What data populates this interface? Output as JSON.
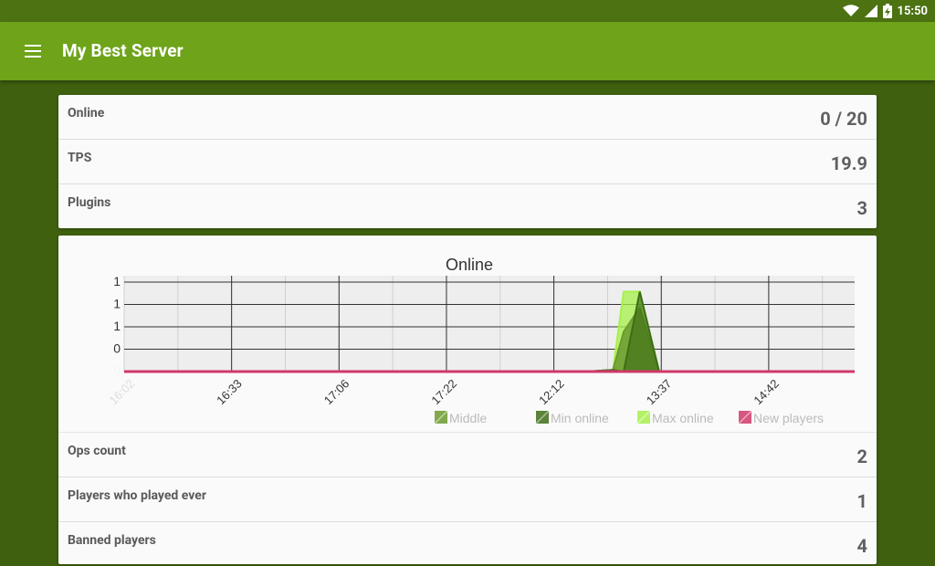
{
  "status_bar": {
    "time": "15:50",
    "icons": [
      "wifi-icon",
      "signal-icon",
      "battery-charging-icon"
    ]
  },
  "app_bar": {
    "title": "My Best Server",
    "menu_icon": "hamburger-menu-icon"
  },
  "summary": [
    {
      "label": "Online",
      "value": "0 / 20"
    },
    {
      "label": "TPS",
      "value": "19.9"
    },
    {
      "label": "Plugins",
      "value": "3"
    }
  ],
  "details": [
    {
      "label": "Ops count",
      "value": "2"
    },
    {
      "label": "Players who played ever",
      "value": "1"
    },
    {
      "label": "Banned players",
      "value": "4"
    }
  ],
  "colors": {
    "status_bar": "#4c7212",
    "app_bar": "#6ea31a",
    "background": "#3f600f",
    "middle": "#6b9a2e",
    "min_online": "#3e6d16",
    "max_online": "#a6f04a",
    "new_players": "#d0386a"
  },
  "chart_data": {
    "type": "area",
    "title": "Online",
    "x_ticks": [
      "16:02",
      "16:33",
      "17:06",
      "17:22",
      "12:12",
      "13:37",
      "14:42"
    ],
    "y_ticks": [
      "1",
      "1",
      "1",
      "0",
      "0"
    ],
    "ylim": [
      0,
      1.2
    ],
    "grid": true,
    "legend_position": "bottom-right",
    "x": [
      0,
      1,
      2,
      3,
      4,
      4.3,
      4.42,
      4.55,
      4.65,
      4.8,
      4.98,
      5.0,
      6,
      6.8
    ],
    "series": [
      {
        "name": "Middle",
        "color": "#6b9a2e",
        "values": [
          0,
          0,
          0,
          0,
          0,
          0,
          0.01,
          0.02,
          0.5,
          0.8,
          0,
          0,
          0,
          0
        ]
      },
      {
        "name": "Min online",
        "color": "#3e6d16",
        "values": [
          0,
          0,
          0,
          0,
          0,
          0,
          0.01,
          0.02,
          0,
          1,
          0,
          0,
          0,
          0
        ]
      },
      {
        "name": "Max online",
        "color": "#a6f04a",
        "values": [
          0,
          0,
          0,
          0,
          0,
          0,
          0.01,
          0.02,
          1,
          1,
          0,
          0,
          0,
          0
        ]
      },
      {
        "name": "New players",
        "color": "#d0386a",
        "values": [
          0,
          0,
          0,
          0,
          0,
          0,
          0,
          0,
          0,
          0,
          0,
          0,
          0,
          0
        ]
      }
    ]
  }
}
